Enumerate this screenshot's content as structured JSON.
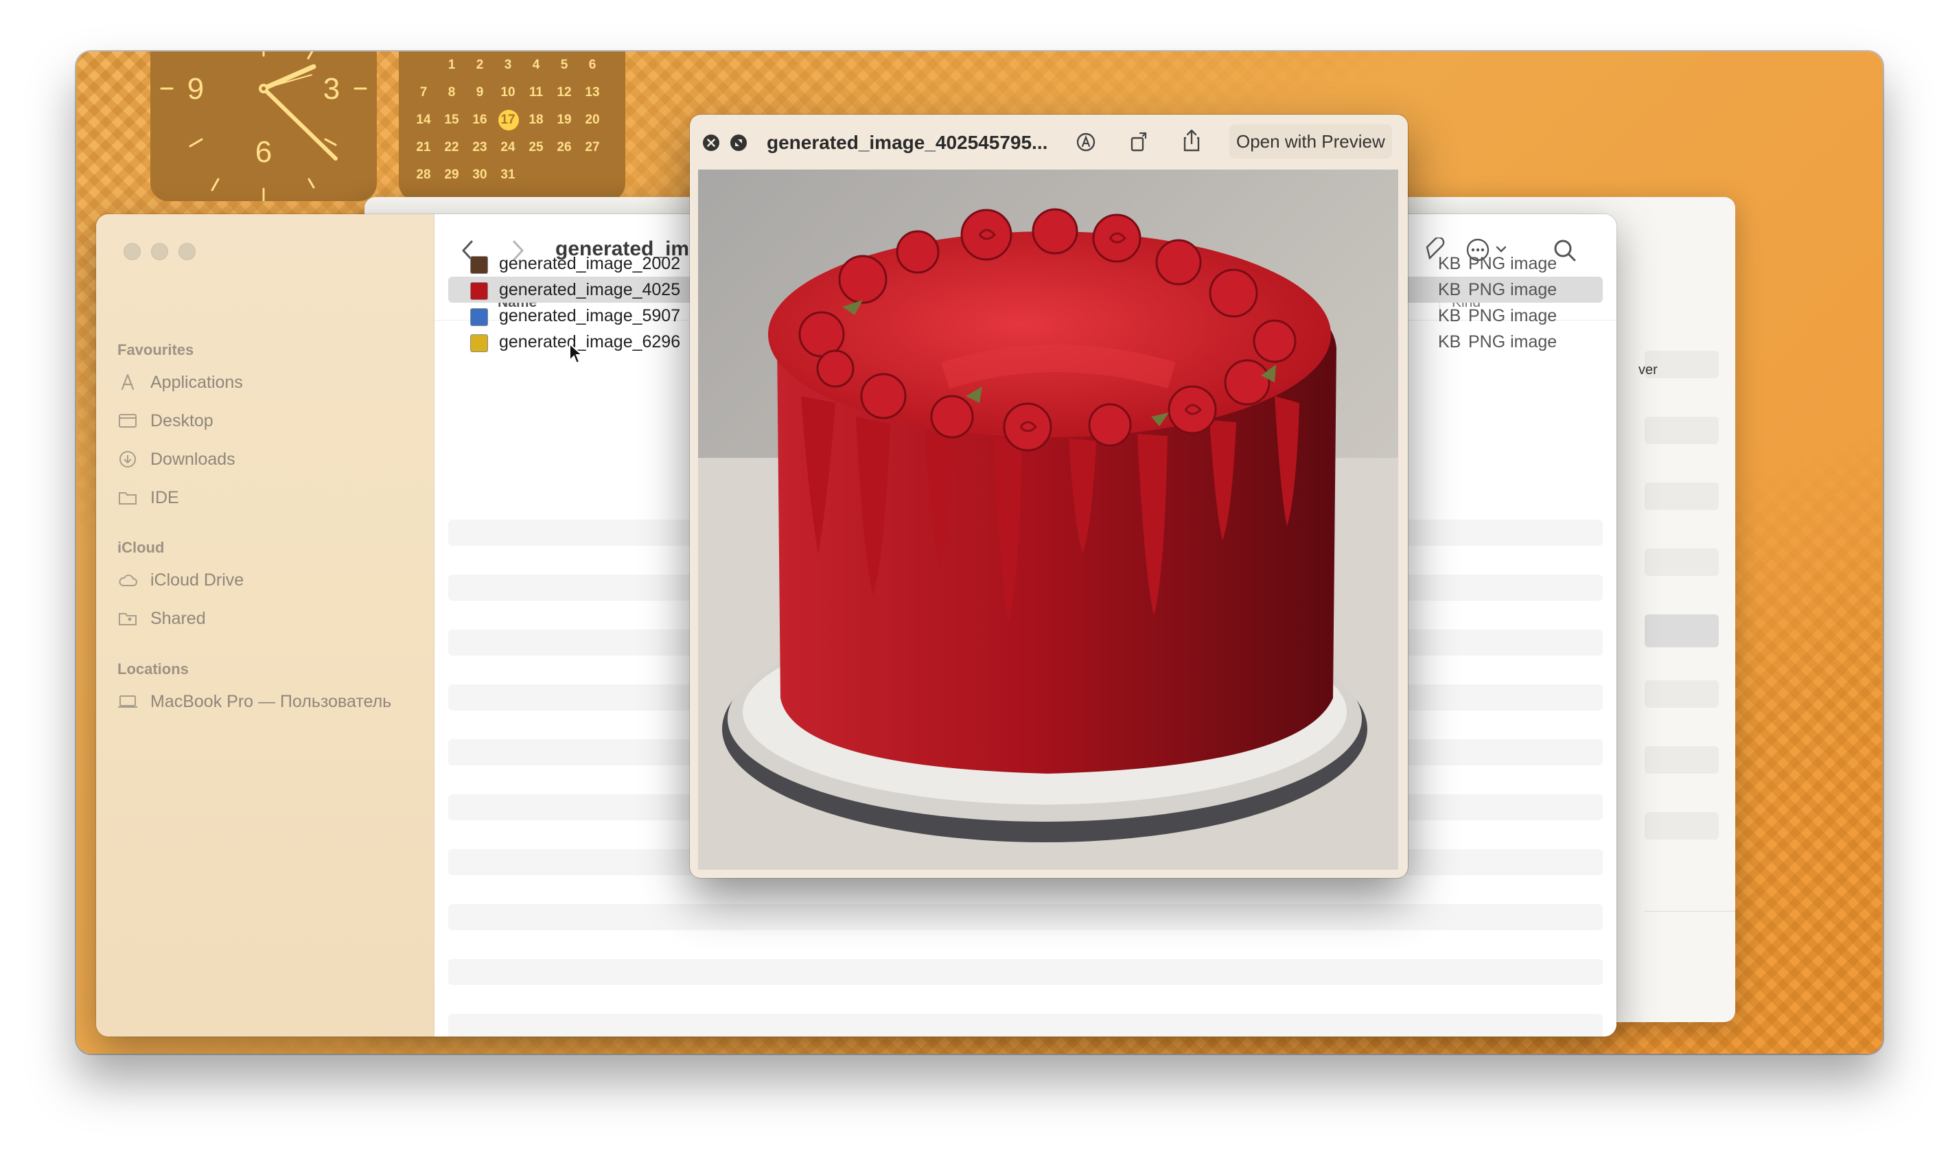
{
  "clock": {
    "numerals": [
      "9",
      "3",
      "6"
    ]
  },
  "calendar": {
    "days": [
      "1",
      "2",
      "3",
      "4",
      "5",
      "6",
      "7",
      "8",
      "9",
      "10",
      "11",
      "12",
      "13",
      "14",
      "15",
      "16",
      "17",
      "18",
      "19",
      "20",
      "21",
      "22",
      "23",
      "24",
      "25",
      "26",
      "27",
      "28",
      "29",
      "30",
      "31"
    ],
    "first_weekday_offset": 1,
    "today": "17"
  },
  "back_window": {
    "visible_text": "ver"
  },
  "finder": {
    "title": "generated_im",
    "sidebar": {
      "favourites_header": "Favourites",
      "favourites": [
        {
          "label": "Applications",
          "icon": "applications-icon"
        },
        {
          "label": "Desktop",
          "icon": "desktop-icon"
        },
        {
          "label": "Downloads",
          "icon": "downloads-icon"
        },
        {
          "label": "IDE",
          "icon": "folder-icon"
        }
      ],
      "icloud_header": "iCloud",
      "icloud": [
        {
          "label": "iCloud Drive",
          "icon": "cloud-icon"
        },
        {
          "label": "Shared",
          "icon": "shared-folder-icon"
        }
      ],
      "locations_header": "Locations",
      "locations": [
        {
          "label": "MacBook Pro — Пользователь",
          "icon": "laptop-icon"
        }
      ]
    },
    "columns": {
      "name": "Name",
      "kind": "Kind"
    },
    "files": [
      {
        "name": "generated_image_2002",
        "size": "KB",
        "kind": "PNG image",
        "thumb_color": "#5a3a22",
        "selected": false
      },
      {
        "name": "generated_image_4025",
        "size": "KB",
        "kind": "PNG image",
        "thumb_color": "#b8141c",
        "selected": true
      },
      {
        "name": "generated_image_5907",
        "size": "KB",
        "kind": "PNG image",
        "thumb_color": "#3a6fc4",
        "selected": false
      },
      {
        "name": "generated_image_6296",
        "size": "KB",
        "kind": "PNG image",
        "thumb_color": "#d8b020",
        "selected": false
      }
    ]
  },
  "quicklook": {
    "title": "generated_image_402545795...",
    "open_button": "Open with Preview",
    "image_description_icon": "red-velvet-cake-image"
  },
  "colors": {
    "wallpaper": "#f0a94c",
    "widget": "#a9742f",
    "widget_text": "#ffe08a",
    "selected_row": "#dcdcdc"
  }
}
